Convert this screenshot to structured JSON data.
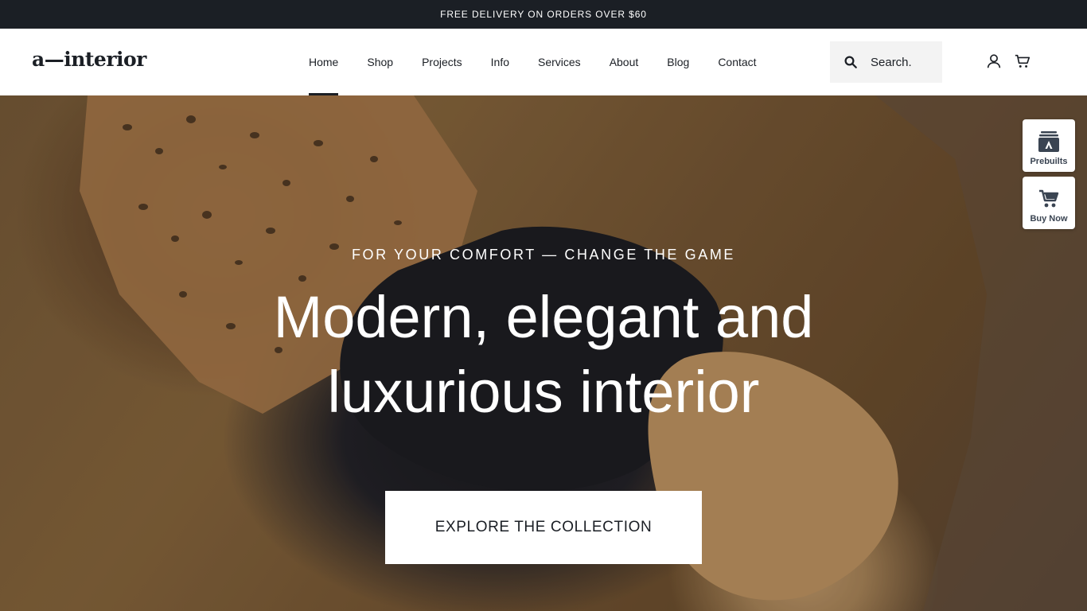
{
  "announcement": "FREE DELIVERY ON ORDERS OVER $60",
  "header": {
    "logo": "a—interior",
    "nav": [
      "Home",
      "Shop",
      "Projects",
      "Info",
      "Services",
      "About",
      "Blog",
      "Contact"
    ],
    "active_nav": "Home",
    "search_placeholder": "Search."
  },
  "icons": {
    "search": "search-icon",
    "account": "user-icon",
    "cart": "cart-icon",
    "prebuilts": "stack-icon",
    "buy_now": "cart-icon"
  },
  "hero": {
    "kicker": "FOR YOUR COMFORT — CHANGE THE GAME",
    "title_line1": "Modern, elegant and",
    "title_line2": "luxurious interior",
    "cta": "EXPLORE THE COLLECTION"
  },
  "side_widgets": {
    "prebuilts": "Prebuilts",
    "buy_now": "Buy Now"
  },
  "colors": {
    "dark": "#1b1f25",
    "white": "#ffffff",
    "search_bg": "#f3f3f3",
    "widget_icon": "#3a4452"
  }
}
